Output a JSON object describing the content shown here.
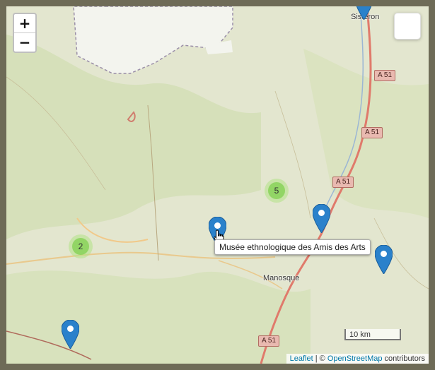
{
  "zoom": {
    "in_label": "+",
    "out_label": "−"
  },
  "tooltip": {
    "text": "Musée ethnologique des Amis des Arts"
  },
  "clusters": [
    {
      "count": "5"
    },
    {
      "count": "2"
    }
  ],
  "places": {
    "sisteron": "Sisteron",
    "manosque": "Manosque"
  },
  "roads": {
    "a51": "A 51"
  },
  "scale": {
    "label": "10 km"
  },
  "attribution": {
    "leaflet": "Leaflet",
    "separator": " | © ",
    "osm": "OpenStreetMap",
    "suffix": " contributors"
  },
  "colors": {
    "marker": "#2a81cb",
    "cluster_outer": "#b5e28c",
    "cluster_inner": "#6ecc39",
    "motorway": "#e07a6b",
    "land": "#e3e6cf",
    "forest": "#cddcb0"
  }
}
